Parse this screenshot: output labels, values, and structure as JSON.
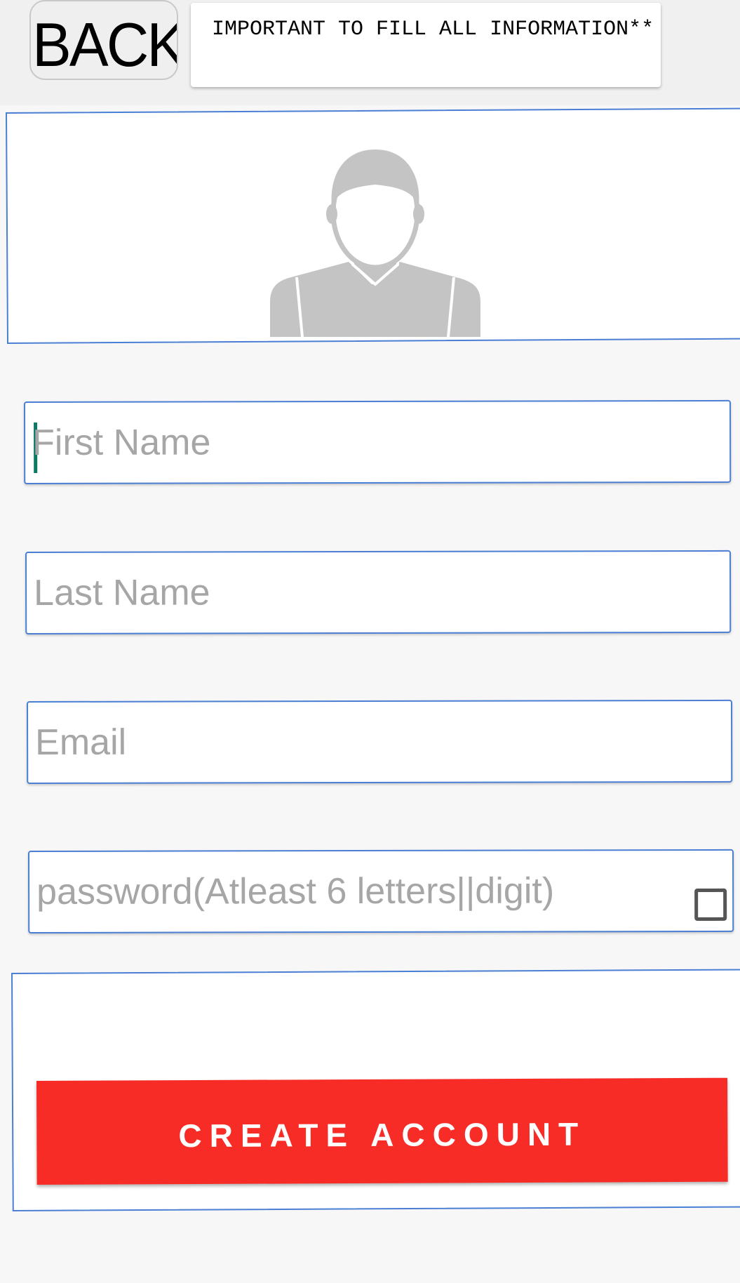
{
  "header": {
    "back_label": "BACK",
    "notice": "IMPORTANT TO FILL ALL INFORMATION**"
  },
  "profile": {
    "avatar_icon": "person-silhouette-icon"
  },
  "form": {
    "first_name_placeholder": "First Name",
    "last_name_placeholder": "Last Name",
    "email_placeholder": "Email",
    "password_placeholder": "password(Atleast 6 letters||digit)",
    "create_label": "CREATE ACCOUNT"
  },
  "colors": {
    "border": "#4a7fd4",
    "button": "#f72c27",
    "placeholder": "#a6a6a6",
    "caret": "#0c7a62"
  }
}
